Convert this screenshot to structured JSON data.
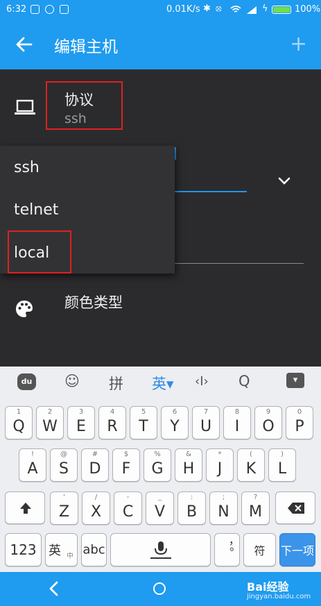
{
  "status_bar": {
    "time": "6:32",
    "speed": "0.01K/s",
    "battery_percent": "100%",
    "battery_level": 1.0
  },
  "app_bar": {
    "title": "编辑主机",
    "back_icon": "arrow-left-icon",
    "add_icon": "plus-icon"
  },
  "protocol": {
    "label": "协议",
    "value": "ssh"
  },
  "dropdown": {
    "options": [
      "ssh",
      "telnet",
      "local"
    ]
  },
  "color_type": {
    "label": "颜色类型"
  },
  "keyboard": {
    "toolbar": [
      "du",
      "☺",
      "拼",
      "英▾",
      "‹I›",
      "Q",
      "▾"
    ],
    "row1": [
      {
        "p": "Q",
        "s": "1"
      },
      {
        "p": "W",
        "s": "2"
      },
      {
        "p": "E",
        "s": "3"
      },
      {
        "p": "R",
        "s": "4"
      },
      {
        "p": "T",
        "s": "5"
      },
      {
        "p": "Y",
        "s": "6"
      },
      {
        "p": "U",
        "s": "7"
      },
      {
        "p": "I",
        "s": "8"
      },
      {
        "p": "O",
        "s": "9"
      },
      {
        "p": "P",
        "s": "0"
      }
    ],
    "row2": [
      {
        "p": "A",
        "s": "!"
      },
      {
        "p": "S",
        "s": "@"
      },
      {
        "p": "D",
        "s": "#"
      },
      {
        "p": "F",
        "s": "$"
      },
      {
        "p": "G",
        "s": "%"
      },
      {
        "p": "H",
        "s": "&"
      },
      {
        "p": "J",
        "s": "*"
      },
      {
        "p": "K",
        "s": "("
      },
      {
        "p": "L",
        "s": ")"
      }
    ],
    "row3": [
      {
        "p": "Z",
        "s": "'"
      },
      {
        "p": "X",
        "s": "/"
      },
      {
        "p": "C",
        "s": "-"
      },
      {
        "p": "V",
        "s": "_"
      },
      {
        "p": "B",
        "s": ":"
      },
      {
        "p": "N",
        "s": ";"
      },
      {
        "p": "M",
        "s": "?"
      }
    ],
    "key_123": "123",
    "key_lang": "英",
    "key_lang_sub": "中",
    "key_abc": "abc",
    "key_punct": "，。",
    "key_symbol": "符",
    "key_next": "下一项"
  },
  "watermark": {
    "text": "Bai经验",
    "sub": "jingyan.baidu.com"
  },
  "colors": {
    "accent": "#1f9bef",
    "background": "#2b2b2e",
    "highlight_box": "#e02020"
  }
}
